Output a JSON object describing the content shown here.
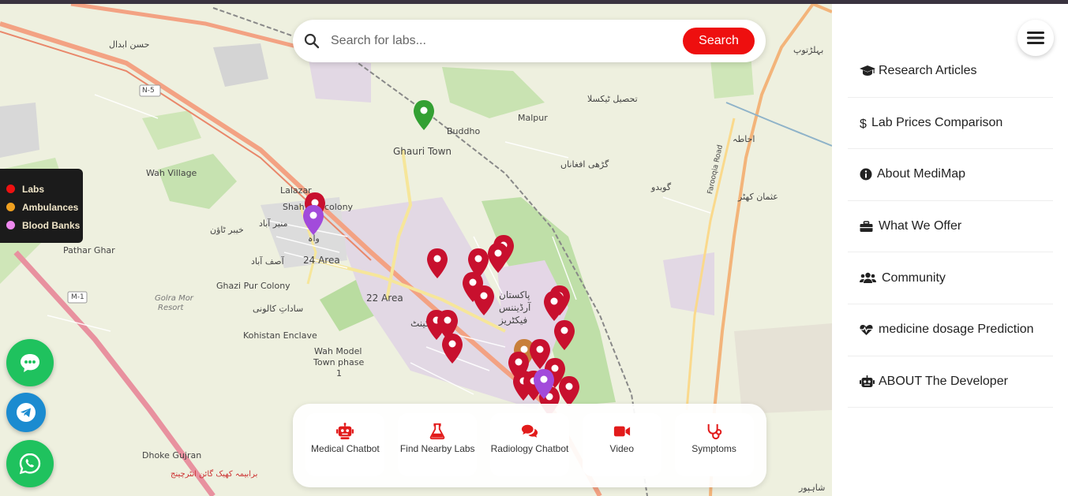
{
  "search": {
    "placeholder": "Search for labs...",
    "button_label": "Search"
  },
  "legend": [
    {
      "label": "Labs",
      "color": "#ee1111"
    },
    {
      "label": "Ambulances",
      "color": "#f0a020"
    },
    {
      "label": "Blood Banks",
      "color": "#ee88ee"
    }
  ],
  "map_labels": [
    "حسن ابدال",
    "Buddho",
    "Malpur",
    "Ghauri Town",
    "گڑھی افغاناں",
    "Wah Village",
    "Lalazar",
    "Shahwali colony",
    "واہ",
    "24 Area",
    "Pathar Ghar",
    "Ghazi Pur Colony",
    "22 Area",
    "Kohistan Enclave",
    "Wah Model",
    "Town phase",
    "1",
    "Dhoke Gujran",
    "Golra Mor",
    "Resort",
    "ساداتِ کالونی",
    "آصف آباد",
    "منیر آباد",
    "خیبر ٹاؤن",
    "گوبدو",
    "عثمان کھٹر",
    "احاطہ",
    "تحصیل ٹیکسلا",
    "بہلڑتوپ",
    "پاکستان",
    "آرڈیننس",
    "فیکٹریز",
    "N-5",
    "M-1",
    "Farooqia Road",
    "شاہپور",
    "برابیمہ کھیک گائن انٹرچینج",
    "واہ کینٹ"
  ],
  "toolbar": [
    {
      "label": "Medical Chatbot",
      "icon": "robot-icon"
    },
    {
      "label": "Find Nearby Labs",
      "icon": "flask-icon"
    },
    {
      "label": "Radiology Chatbot",
      "icon": "comments-icon"
    },
    {
      "label": "Video",
      "icon": "video-icon"
    },
    {
      "label": "Symptoms",
      "icon": "stethoscope-icon"
    }
  ],
  "nav": [
    {
      "label": "Research Articles",
      "icon": "graduation-cap-icon"
    },
    {
      "label": "Lab Prices Comparison",
      "icon": "dollar-icon"
    },
    {
      "label": "About MediMap",
      "icon": "info-icon"
    },
    {
      "label": "What We Offer",
      "icon": "briefcase-icon"
    },
    {
      "label": "Community",
      "icon": "users-icon"
    },
    {
      "label": "medicine dosage Prediction",
      "icon": "heart-pulse-icon"
    },
    {
      "label": "ABOUT The Developer",
      "icon": "robot-icon"
    }
  ],
  "colors": {
    "accent": "#ee0f0f",
    "lab_marker": "#c8102e",
    "blood_bank_marker": "#a24bdb",
    "current_location": "#33a033",
    "ambulance_marker": "#c87f3a"
  }
}
